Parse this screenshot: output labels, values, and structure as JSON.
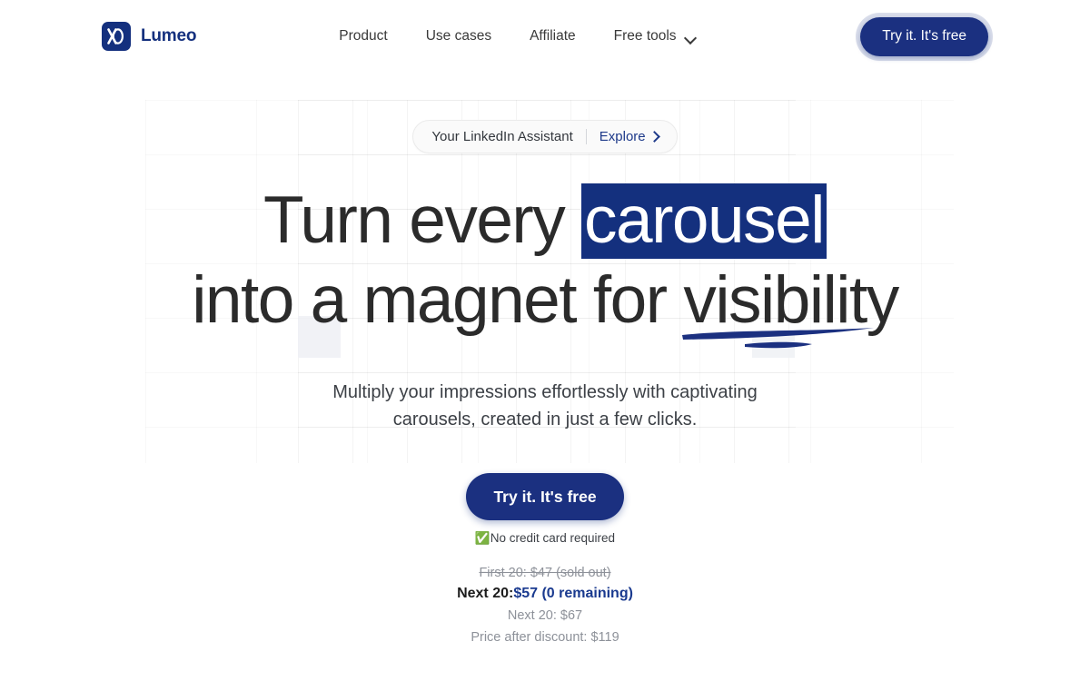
{
  "brand": {
    "name": "Lumeo",
    "mark_icon": "lumeo-x-o-logo-icon"
  },
  "nav": {
    "items": [
      {
        "label": "Product"
      },
      {
        "label": "Use cases"
      },
      {
        "label": "Affiliate"
      }
    ],
    "dropdown": {
      "label": "Free tools",
      "icon": "chevron-down-icon"
    }
  },
  "header": {
    "cta_label": "Try it. It's free"
  },
  "hero": {
    "badge": {
      "text": "Your LinkedIn Assistant",
      "link_label": "Explore",
      "link_icon": "chevron-right-icon"
    },
    "headline": {
      "line1_prefix": "Turn every ",
      "line1_highlight": "carousel",
      "line2_prefix": "into a magnet for ",
      "line2_underlined": "visibility"
    },
    "subhead": {
      "line1": "Multiply your impressions effortlessly with captivating",
      "line2": "carousels, created in just a few clicks."
    },
    "cta_label": "Try it. It's free",
    "no_card": {
      "icon": "white-check-mark-emoji",
      "text": "No credit card required"
    },
    "pricing": {
      "sold_out": "First 20: $47 (sold out)",
      "current_label": "Next 20:",
      "current_value": "$57 (0 remaining)",
      "next_tier": "Next 20: $67",
      "after_discount": "Price after discount: $119"
    }
  },
  "colors": {
    "brand_navy": "#14307e",
    "cta_navy": "#1b3080",
    "link_navy": "#1e3a8a",
    "price_blue": "#1a3a8f",
    "muted_gray": "#8d9199",
    "text_dark": "#2b2b2b"
  }
}
